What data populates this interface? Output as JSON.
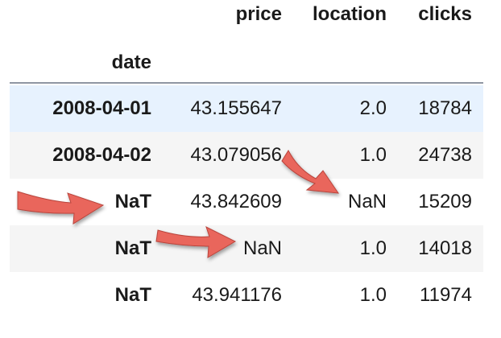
{
  "table": {
    "columns": [
      "price",
      "location",
      "clicks"
    ],
    "index_name": "date",
    "rows": [
      {
        "date": "2008-04-01",
        "price": "43.155647",
        "location": "2.0",
        "clicks": "18784"
      },
      {
        "date": "2008-04-02",
        "price": "43.079056",
        "location": "1.0",
        "clicks": "24738"
      },
      {
        "date": "NaT",
        "price": "43.842609",
        "location": "NaN",
        "clicks": "15209"
      },
      {
        "date": "NaT",
        "price": "NaN",
        "location": "1.0",
        "clicks": "14018"
      },
      {
        "date": "NaT",
        "price": "43.941176",
        "location": "1.0",
        "clicks": "11974"
      }
    ]
  },
  "colors": {
    "highlight_row": "#e7f2fe",
    "striped_row": "#f5f5f5",
    "arrow": "#e9665c"
  },
  "annotations": [
    {
      "icon": "arrow-icon",
      "points_to": "date NaT (row 3)"
    },
    {
      "icon": "arrow-icon",
      "points_to": "location NaN (row 3)"
    },
    {
      "icon": "arrow-icon",
      "points_to": "price NaN (row 4)"
    }
  ]
}
